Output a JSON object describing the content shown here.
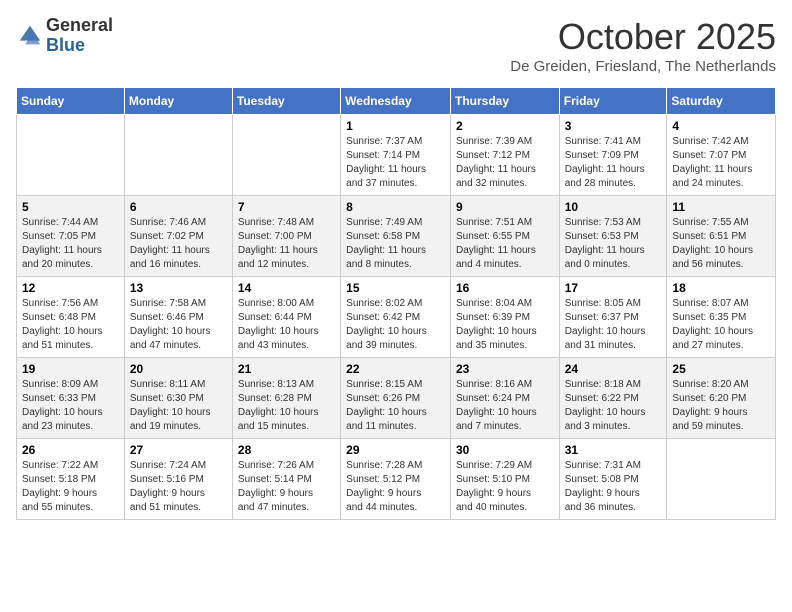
{
  "header": {
    "logo_general": "General",
    "logo_blue": "Blue",
    "month_title": "October 2025",
    "location": "De Greiden, Friesland, The Netherlands"
  },
  "days_of_week": [
    "Sunday",
    "Monday",
    "Tuesday",
    "Wednesday",
    "Thursday",
    "Friday",
    "Saturday"
  ],
  "weeks": [
    [
      {
        "day": "",
        "info": ""
      },
      {
        "day": "",
        "info": ""
      },
      {
        "day": "",
        "info": ""
      },
      {
        "day": "1",
        "info": "Sunrise: 7:37 AM\nSunset: 7:14 PM\nDaylight: 11 hours\nand 37 minutes."
      },
      {
        "day": "2",
        "info": "Sunrise: 7:39 AM\nSunset: 7:12 PM\nDaylight: 11 hours\nand 32 minutes."
      },
      {
        "day": "3",
        "info": "Sunrise: 7:41 AM\nSunset: 7:09 PM\nDaylight: 11 hours\nand 28 minutes."
      },
      {
        "day": "4",
        "info": "Sunrise: 7:42 AM\nSunset: 7:07 PM\nDaylight: 11 hours\nand 24 minutes."
      }
    ],
    [
      {
        "day": "5",
        "info": "Sunrise: 7:44 AM\nSunset: 7:05 PM\nDaylight: 11 hours\nand 20 minutes."
      },
      {
        "day": "6",
        "info": "Sunrise: 7:46 AM\nSunset: 7:02 PM\nDaylight: 11 hours\nand 16 minutes."
      },
      {
        "day": "7",
        "info": "Sunrise: 7:48 AM\nSunset: 7:00 PM\nDaylight: 11 hours\nand 12 minutes."
      },
      {
        "day": "8",
        "info": "Sunrise: 7:49 AM\nSunset: 6:58 PM\nDaylight: 11 hours\nand 8 minutes."
      },
      {
        "day": "9",
        "info": "Sunrise: 7:51 AM\nSunset: 6:55 PM\nDaylight: 11 hours\nand 4 minutes."
      },
      {
        "day": "10",
        "info": "Sunrise: 7:53 AM\nSunset: 6:53 PM\nDaylight: 11 hours\nand 0 minutes."
      },
      {
        "day": "11",
        "info": "Sunrise: 7:55 AM\nSunset: 6:51 PM\nDaylight: 10 hours\nand 56 minutes."
      }
    ],
    [
      {
        "day": "12",
        "info": "Sunrise: 7:56 AM\nSunset: 6:48 PM\nDaylight: 10 hours\nand 51 minutes."
      },
      {
        "day": "13",
        "info": "Sunrise: 7:58 AM\nSunset: 6:46 PM\nDaylight: 10 hours\nand 47 minutes."
      },
      {
        "day": "14",
        "info": "Sunrise: 8:00 AM\nSunset: 6:44 PM\nDaylight: 10 hours\nand 43 minutes."
      },
      {
        "day": "15",
        "info": "Sunrise: 8:02 AM\nSunset: 6:42 PM\nDaylight: 10 hours\nand 39 minutes."
      },
      {
        "day": "16",
        "info": "Sunrise: 8:04 AM\nSunset: 6:39 PM\nDaylight: 10 hours\nand 35 minutes."
      },
      {
        "day": "17",
        "info": "Sunrise: 8:05 AM\nSunset: 6:37 PM\nDaylight: 10 hours\nand 31 minutes."
      },
      {
        "day": "18",
        "info": "Sunrise: 8:07 AM\nSunset: 6:35 PM\nDaylight: 10 hours\nand 27 minutes."
      }
    ],
    [
      {
        "day": "19",
        "info": "Sunrise: 8:09 AM\nSunset: 6:33 PM\nDaylight: 10 hours\nand 23 minutes."
      },
      {
        "day": "20",
        "info": "Sunrise: 8:11 AM\nSunset: 6:30 PM\nDaylight: 10 hours\nand 19 minutes."
      },
      {
        "day": "21",
        "info": "Sunrise: 8:13 AM\nSunset: 6:28 PM\nDaylight: 10 hours\nand 15 minutes."
      },
      {
        "day": "22",
        "info": "Sunrise: 8:15 AM\nSunset: 6:26 PM\nDaylight: 10 hours\nand 11 minutes."
      },
      {
        "day": "23",
        "info": "Sunrise: 8:16 AM\nSunset: 6:24 PM\nDaylight: 10 hours\nand 7 minutes."
      },
      {
        "day": "24",
        "info": "Sunrise: 8:18 AM\nSunset: 6:22 PM\nDaylight: 10 hours\nand 3 minutes."
      },
      {
        "day": "25",
        "info": "Sunrise: 8:20 AM\nSunset: 6:20 PM\nDaylight: 9 hours\nand 59 minutes."
      }
    ],
    [
      {
        "day": "26",
        "info": "Sunrise: 7:22 AM\nSunset: 5:18 PM\nDaylight: 9 hours\nand 55 minutes."
      },
      {
        "day": "27",
        "info": "Sunrise: 7:24 AM\nSunset: 5:16 PM\nDaylight: 9 hours\nand 51 minutes."
      },
      {
        "day": "28",
        "info": "Sunrise: 7:26 AM\nSunset: 5:14 PM\nDaylight: 9 hours\nand 47 minutes."
      },
      {
        "day": "29",
        "info": "Sunrise: 7:28 AM\nSunset: 5:12 PM\nDaylight: 9 hours\nand 44 minutes."
      },
      {
        "day": "30",
        "info": "Sunrise: 7:29 AM\nSunset: 5:10 PM\nDaylight: 9 hours\nand 40 minutes."
      },
      {
        "day": "31",
        "info": "Sunrise: 7:31 AM\nSunset: 5:08 PM\nDaylight: 9 hours\nand 36 minutes."
      },
      {
        "day": "",
        "info": ""
      }
    ]
  ]
}
